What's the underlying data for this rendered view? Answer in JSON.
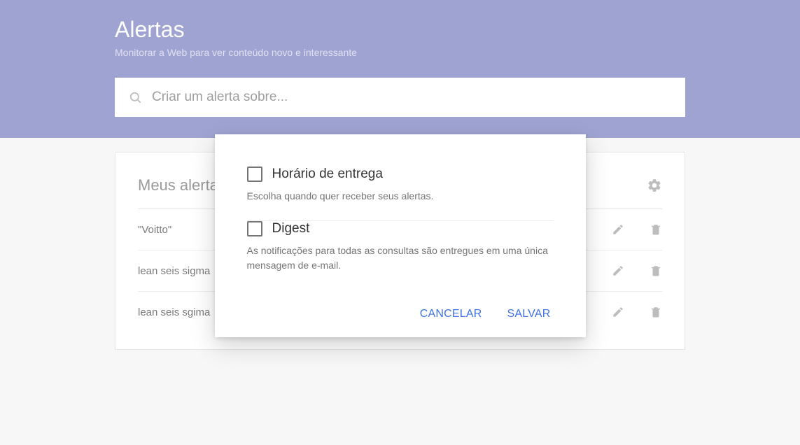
{
  "header": {
    "title": "Alertas",
    "subtitle": "Monitorar a Web para ver conteúdo novo e interessante",
    "search_placeholder": "Criar um alerta sobre..."
  },
  "my_alerts": {
    "heading": "Meus alertas",
    "rows": [
      {
        "label": "\"Voitto\""
      },
      {
        "label": "lean seis sigma"
      },
      {
        "label": "lean seis sgima"
      }
    ]
  },
  "modal": {
    "option1": {
      "label": "Horário de entrega",
      "desc": "Escolha quando quer receber seus alertas."
    },
    "option2": {
      "label": "Digest",
      "desc": "As notificações para todas as consultas são entregues em uma única mensagem de e-mail."
    },
    "cancel": "CANCELAR",
    "save": "SALVAR"
  }
}
